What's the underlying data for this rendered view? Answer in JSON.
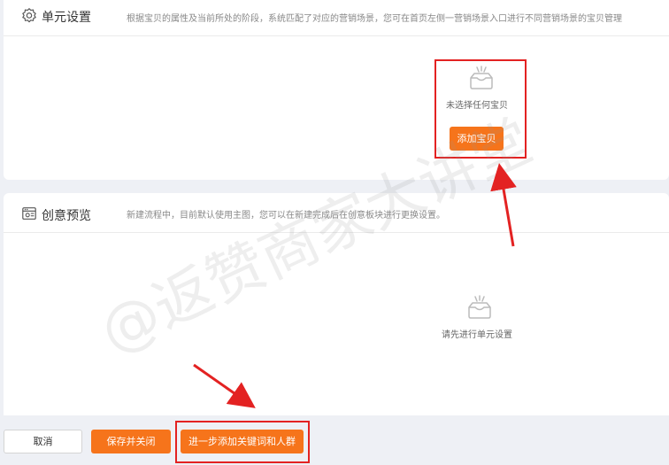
{
  "unit_section": {
    "title": "单元设置",
    "description": "根据宝贝的属性及当前所处的阶段，系统匹配了对应的营销场景，您可在首页左侧一营销场景入口进行不同营销场景的宝贝管理",
    "empty_text": "未选择任何宝贝",
    "add_button_label": "添加宝贝",
    "icon": "gear-icon"
  },
  "creative_section": {
    "title": "创意预览",
    "description": "新建流程中，目前默认使用主图，您可以在新建完成后在创意板块进行更换设置。",
    "empty_text": "请先进行单元设置",
    "icon": "image-frame-icon"
  },
  "footer": {
    "cancel_label": "取消",
    "save_close_label": "保存并关闭",
    "next_label": "进一步添加关键词和人群"
  },
  "watermark": "@返赞商家大讲堂",
  "colors": {
    "accent": "#f6741b",
    "highlight": "#e32222",
    "background": "#eef0f5"
  }
}
